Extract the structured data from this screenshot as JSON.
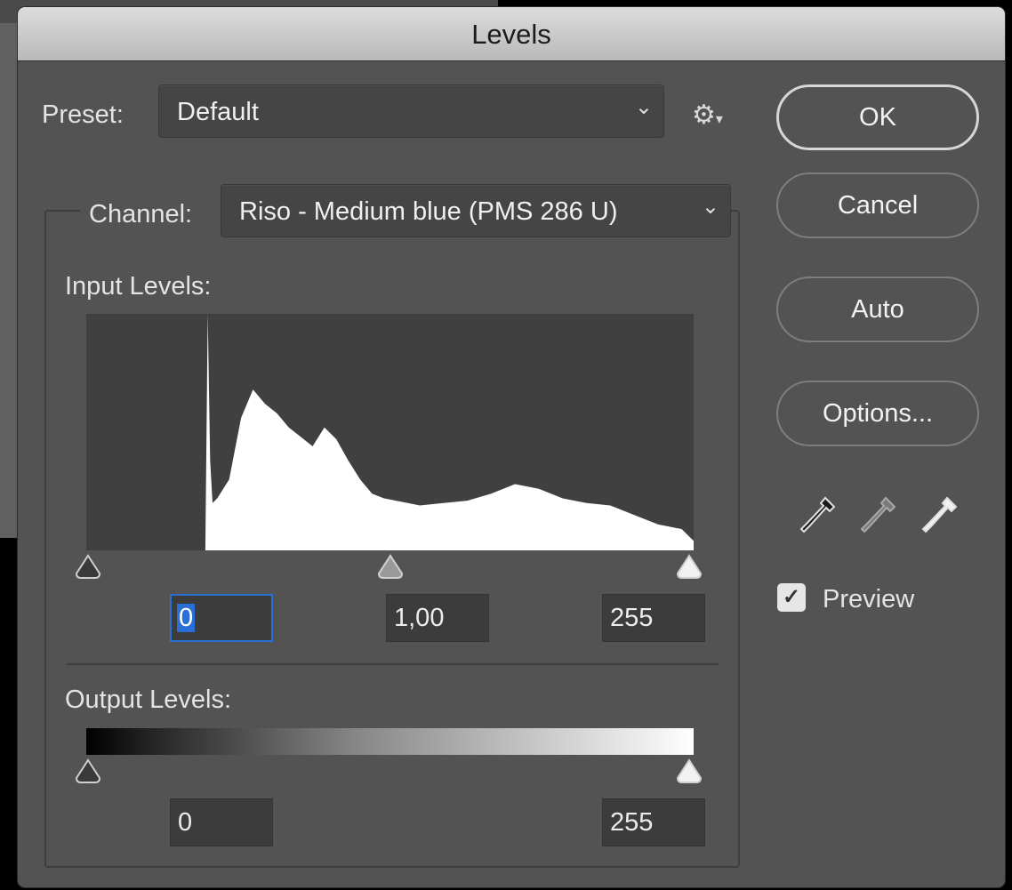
{
  "dialog": {
    "title": "Levels"
  },
  "preset": {
    "label": "Preset:",
    "value": "Default",
    "menu_icon": "gear-icon"
  },
  "channel": {
    "label": "Channel:",
    "value": "Riso - Medium blue (PMS 286 U)"
  },
  "input_levels": {
    "label": "Input Levels:",
    "black": "0",
    "gamma": "1,00",
    "white": "255"
  },
  "output_levels": {
    "label": "Output Levels:",
    "black": "0",
    "white": "255"
  },
  "buttons": {
    "ok": "OK",
    "cancel": "Cancel",
    "auto": "Auto",
    "options": "Options..."
  },
  "eyedroppers": [
    "black-point-eyedropper-icon",
    "gray-point-eyedropper-icon",
    "white-point-eyedropper-icon"
  ],
  "preview": {
    "label": "Preview",
    "checked": true
  },
  "chart_data": {
    "type": "area",
    "x": [
      0,
      10,
      20,
      30,
      40,
      50,
      51,
      52,
      53,
      55,
      60,
      65,
      70,
      75,
      80,
      85,
      90,
      95,
      100,
      105,
      110,
      115,
      120,
      125,
      130,
      135,
      140,
      150,
      160,
      170,
      180,
      190,
      200,
      210,
      220,
      230,
      240,
      250,
      255
    ],
    "values": [
      0,
      0,
      0,
      0,
      0,
      0,
      100,
      38,
      20,
      22,
      30,
      56,
      68,
      62,
      58,
      52,
      48,
      44,
      52,
      47,
      38,
      30,
      24,
      22,
      21,
      20,
      19,
      20,
      21,
      24,
      28,
      26,
      22,
      20,
      19,
      15,
      11,
      9,
      4
    ],
    "xlim": [
      0,
      255
    ],
    "ylim": [
      0,
      100
    ]
  },
  "colors": {
    "dialog_bg": "#535353",
    "focus": "#2a6fd6",
    "histogram_bg": "#404040",
    "histogram_fill": "#ffffff"
  }
}
